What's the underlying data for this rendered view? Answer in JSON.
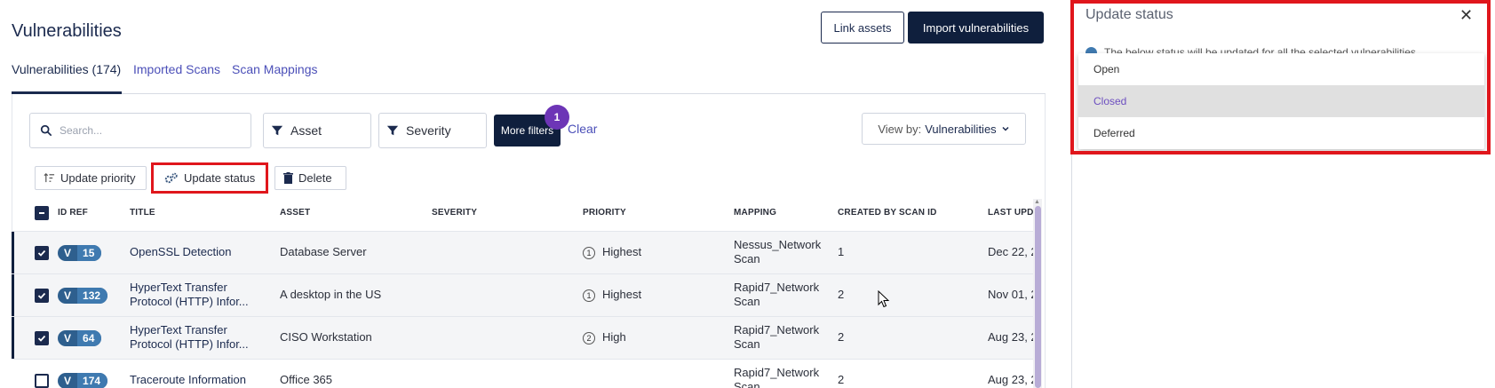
{
  "page": {
    "title": "Vulnerabilities",
    "link_assets": "Link assets",
    "import_vulnerabilities": "Import vulnerabilities"
  },
  "tabs": [
    {
      "label": "Vulnerabilities (174)"
    },
    {
      "label": "Imported Scans"
    },
    {
      "label": "Scan Mappings"
    }
  ],
  "filters": {
    "search_placeholder": "Search...",
    "asset": "Asset",
    "severity": "Severity",
    "more_filters": "More filters",
    "badge_count": "1",
    "clear": "Clear",
    "view_by_label": "View by:",
    "view_by_value": "Vulnerabilities"
  },
  "actions": {
    "update_priority": "Update priority",
    "update_status": "Update status",
    "delete": "Delete"
  },
  "table": {
    "headers": [
      "ID REF",
      "TITLE",
      "ASSET",
      "SEVERITY",
      "PRIORITY",
      "MAPPING",
      "CREATED BY SCAN ID",
      "LAST UPDA"
    ],
    "rows": [
      {
        "checked": true,
        "v": "V",
        "id": "15",
        "title1": "OpenSSL Detection",
        "title2": "",
        "asset": "Database Server",
        "severity": "",
        "priority_icon": "1",
        "priority": "Highest",
        "mapping1": "Nessus_Network",
        "mapping2": "Scan",
        "scan_id": "1",
        "last_updated": "Dec 22, 2"
      },
      {
        "checked": true,
        "v": "V",
        "id": "132",
        "title1": "HyperText Transfer",
        "title2": "Protocol (HTTP) Infor...",
        "asset": "A desktop in the US",
        "severity": "",
        "priority_icon": "1",
        "priority": "Highest",
        "mapping1": "Rapid7_Network",
        "mapping2": "Scan",
        "scan_id": "2",
        "last_updated": "Nov 01, 2"
      },
      {
        "checked": true,
        "v": "V",
        "id": "64",
        "title1": "HyperText Transfer",
        "title2": "Protocol (HTTP) Infor...",
        "asset": "CISO Workstation",
        "severity": "",
        "priority_icon": "2",
        "priority": "High",
        "mapping1": "Rapid7_Network",
        "mapping2": "Scan",
        "scan_id": "2",
        "last_updated": "Aug 23, 2"
      },
      {
        "checked": false,
        "v": "V",
        "id": "174",
        "title1": "Traceroute Information",
        "title2": "",
        "asset": "Office 365",
        "severity": "",
        "priority_icon": "",
        "priority": "",
        "mapping1": "Rapid7_Network",
        "mapping2": "Scan",
        "scan_id": "2",
        "last_updated": "Aug 23, 2"
      }
    ]
  },
  "drawer": {
    "title": "Update status",
    "close": "✕",
    "info": "The below status will be updated for all the selected vulnerabilities",
    "options": [
      "Open",
      "Closed",
      "Deferred"
    ],
    "hovered_option": "Closed"
  }
}
